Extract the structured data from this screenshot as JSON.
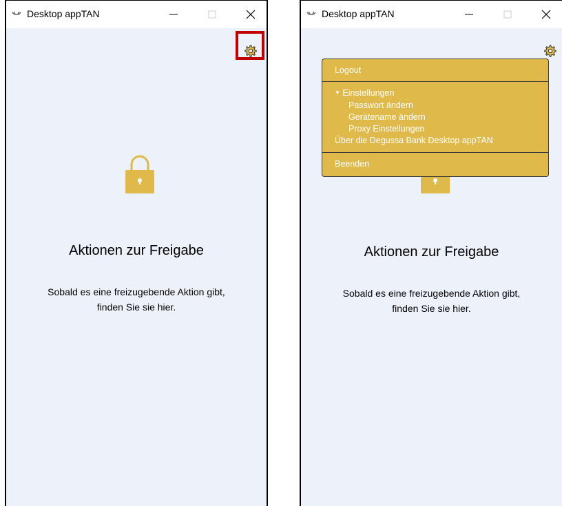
{
  "colors": {
    "accent": "#dfb94a",
    "background": "#edf1fa",
    "highlight": "#c00000",
    "text": "#000000"
  },
  "windows": [
    {
      "title": "Desktop appTAN",
      "icon": "app-logo-icon",
      "heading": "Aktionen zur Freigabe",
      "description_line1": "Sobald es eine freizugebende Aktion gibt,",
      "description_line2": "finden Sie sie hier."
    },
    {
      "title": "Desktop appTAN",
      "icon": "app-logo-icon",
      "heading": "Aktionen zur Freigabe",
      "description_line1": "Sobald es eine freizugebende Aktion gibt,",
      "description_line2": "finden Sie sie hier.",
      "menu": {
        "logout": "Logout",
        "settings": "Einstellungen",
        "change_password": "Passwort ändern",
        "change_device_name": "Gerätename ändern",
        "proxy_settings": "Proxy Einstellungen",
        "about": "Über die Degussa Bank Desktop appTAN",
        "quit": "Beenden"
      }
    }
  ]
}
